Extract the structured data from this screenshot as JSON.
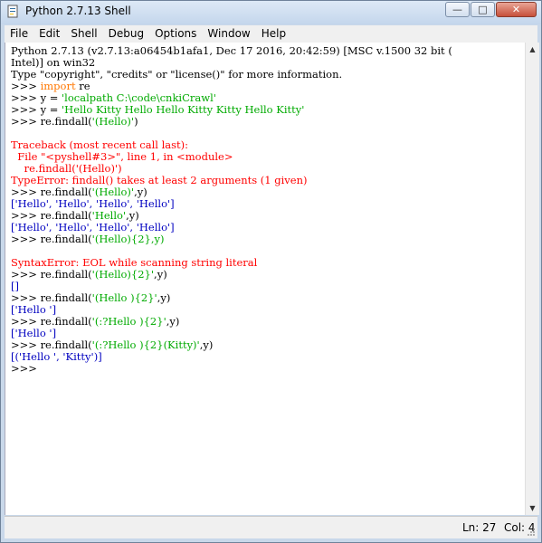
{
  "window": {
    "title": "Python 2.7.13 Shell",
    "minimize": "—",
    "maximize": "□",
    "close": "✕"
  },
  "menu": [
    "File",
    "Edit",
    "Shell",
    "Debug",
    "Options",
    "Window",
    "Help"
  ],
  "lines": [
    [
      {
        "t": "Python 2.7.13 (v2.7.13:a06454b1afa1, Dec 17 2016, 20:42:59) [MSC v.1500 32 bit (",
        "c": ""
      }
    ],
    [
      {
        "t": "Intel)] on win32",
        "c": ""
      }
    ],
    [
      {
        "t": "Type \"copyright\", \"credits\" or \"license()\" for more information.",
        "c": ""
      }
    ],
    [
      {
        "t": ">>> ",
        "c": ""
      },
      {
        "t": "import",
        "c": "kw"
      },
      {
        "t": " re",
        "c": ""
      }
    ],
    [
      {
        "t": ">>> y = ",
        "c": ""
      },
      {
        "t": "'localpath C:\\code\\cnkiCrawl'",
        "c": "str"
      }
    ],
    [
      {
        "t": ">>> y = ",
        "c": ""
      },
      {
        "t": "'Hello Kitty Hello Hello Kitty Kitty Hello Kitty'",
        "c": "str"
      }
    ],
    [
      {
        "t": ">>> re.findall(",
        "c": ""
      },
      {
        "t": "'(Hello)'",
        "c": "str"
      },
      {
        "t": ")",
        "c": ""
      }
    ],
    [],
    [
      {
        "t": "Traceback (most recent call last):",
        "c": "err"
      }
    ],
    [
      {
        "t": "  File \"<pyshell#3>\", line 1, in <module>",
        "c": "err"
      }
    ],
    [
      {
        "t": "    re.findall('(Hello)')",
        "c": "err"
      }
    ],
    [
      {
        "t": "TypeError: findall() takes at least 2 arguments (1 given)",
        "c": "err"
      }
    ],
    [
      {
        "t": ">>> re.findall(",
        "c": ""
      },
      {
        "t": "'(Hello)'",
        "c": "str"
      },
      {
        "t": ",y)",
        "c": ""
      }
    ],
    [
      {
        "t": "['Hello', 'Hello', 'Hello', 'Hello']",
        "c": "out"
      }
    ],
    [
      {
        "t": ">>> re.findall(",
        "c": ""
      },
      {
        "t": "'Hello'",
        "c": "str"
      },
      {
        "t": ",y)",
        "c": ""
      }
    ],
    [
      {
        "t": "['Hello', 'Hello', 'Hello', 'Hello']",
        "c": "out"
      }
    ],
    [
      {
        "t": ">>> re.findall(",
        "c": ""
      },
      {
        "t": "'(Hello){2},y)",
        "c": "str"
      }
    ],
    [],
    [
      {
        "t": "SyntaxError: EOL while scanning string literal",
        "c": "err"
      }
    ],
    [
      {
        "t": ">>> re.findall(",
        "c": ""
      },
      {
        "t": "'(Hello){2}'",
        "c": "str"
      },
      {
        "t": ",y)",
        "c": ""
      }
    ],
    [
      {
        "t": "[]",
        "c": "out"
      }
    ],
    [
      {
        "t": ">>> re.findall(",
        "c": ""
      },
      {
        "t": "'(Hello ){2}'",
        "c": "str"
      },
      {
        "t": ",y)",
        "c": ""
      }
    ],
    [
      {
        "t": "['Hello ']",
        "c": "out"
      }
    ],
    [
      {
        "t": ">>> re.findall(",
        "c": ""
      },
      {
        "t": "'(:?Hello ){2}'",
        "c": "str"
      },
      {
        "t": ",y)",
        "c": ""
      }
    ],
    [
      {
        "t": "['Hello ']",
        "c": "out"
      }
    ],
    [
      {
        "t": ">>> re.findall(",
        "c": ""
      },
      {
        "t": "'(:?Hello ){2}(Kitty)'",
        "c": "str"
      },
      {
        "t": ",y)",
        "c": ""
      }
    ],
    [
      {
        "t": "[('Hello ', 'Kitty')]",
        "c": "out"
      }
    ],
    [
      {
        "t": ">>> ",
        "c": ""
      }
    ]
  ],
  "status": {
    "line": "Ln: 27",
    "col": "Col: 4"
  }
}
